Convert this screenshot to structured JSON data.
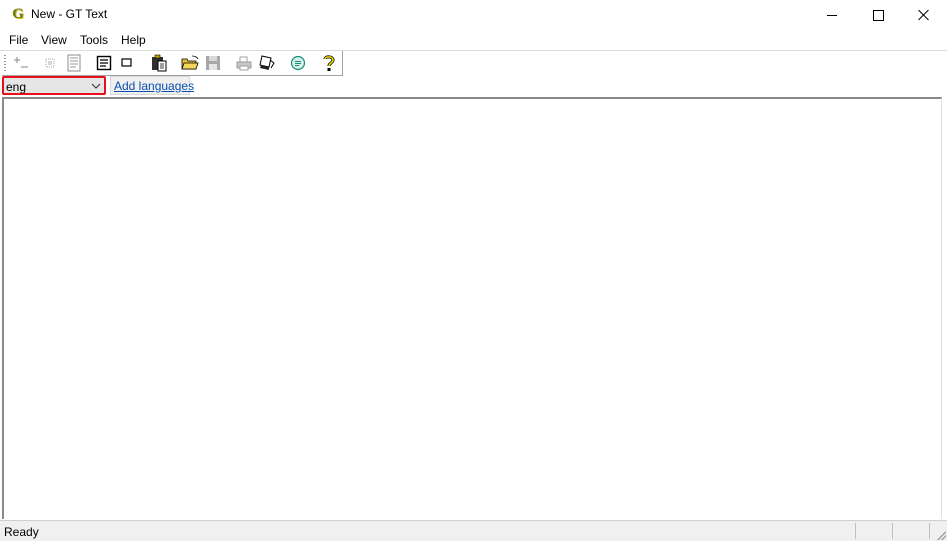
{
  "window": {
    "app_icon_letter": "G",
    "title": "New - GT Text"
  },
  "menu": {
    "items": [
      "File",
      "View",
      "Tools",
      "Help"
    ]
  },
  "toolbar": {
    "buttons": [
      {
        "icon": "add-zone-icon"
      },
      {
        "icon": "select-area-icon"
      },
      {
        "icon": "page-layout-icon"
      },
      {
        "icon": "text-document-icon"
      },
      {
        "icon": "rectangle-icon"
      },
      {
        "icon": "paste-clipboard-icon"
      },
      {
        "icon": "open-folder-icon"
      },
      {
        "icon": "save-disk-icon"
      },
      {
        "icon": "print-icon"
      },
      {
        "icon": "scan-icon"
      },
      {
        "icon": "ocr-recognize-icon"
      },
      {
        "icon": "help-question-icon"
      }
    ]
  },
  "language": {
    "selected": "eng",
    "add_link": "Add languages"
  },
  "status": {
    "text": "Ready"
  },
  "colors": {
    "highlight_border": "#e8101b",
    "link": "#0b4fae"
  }
}
